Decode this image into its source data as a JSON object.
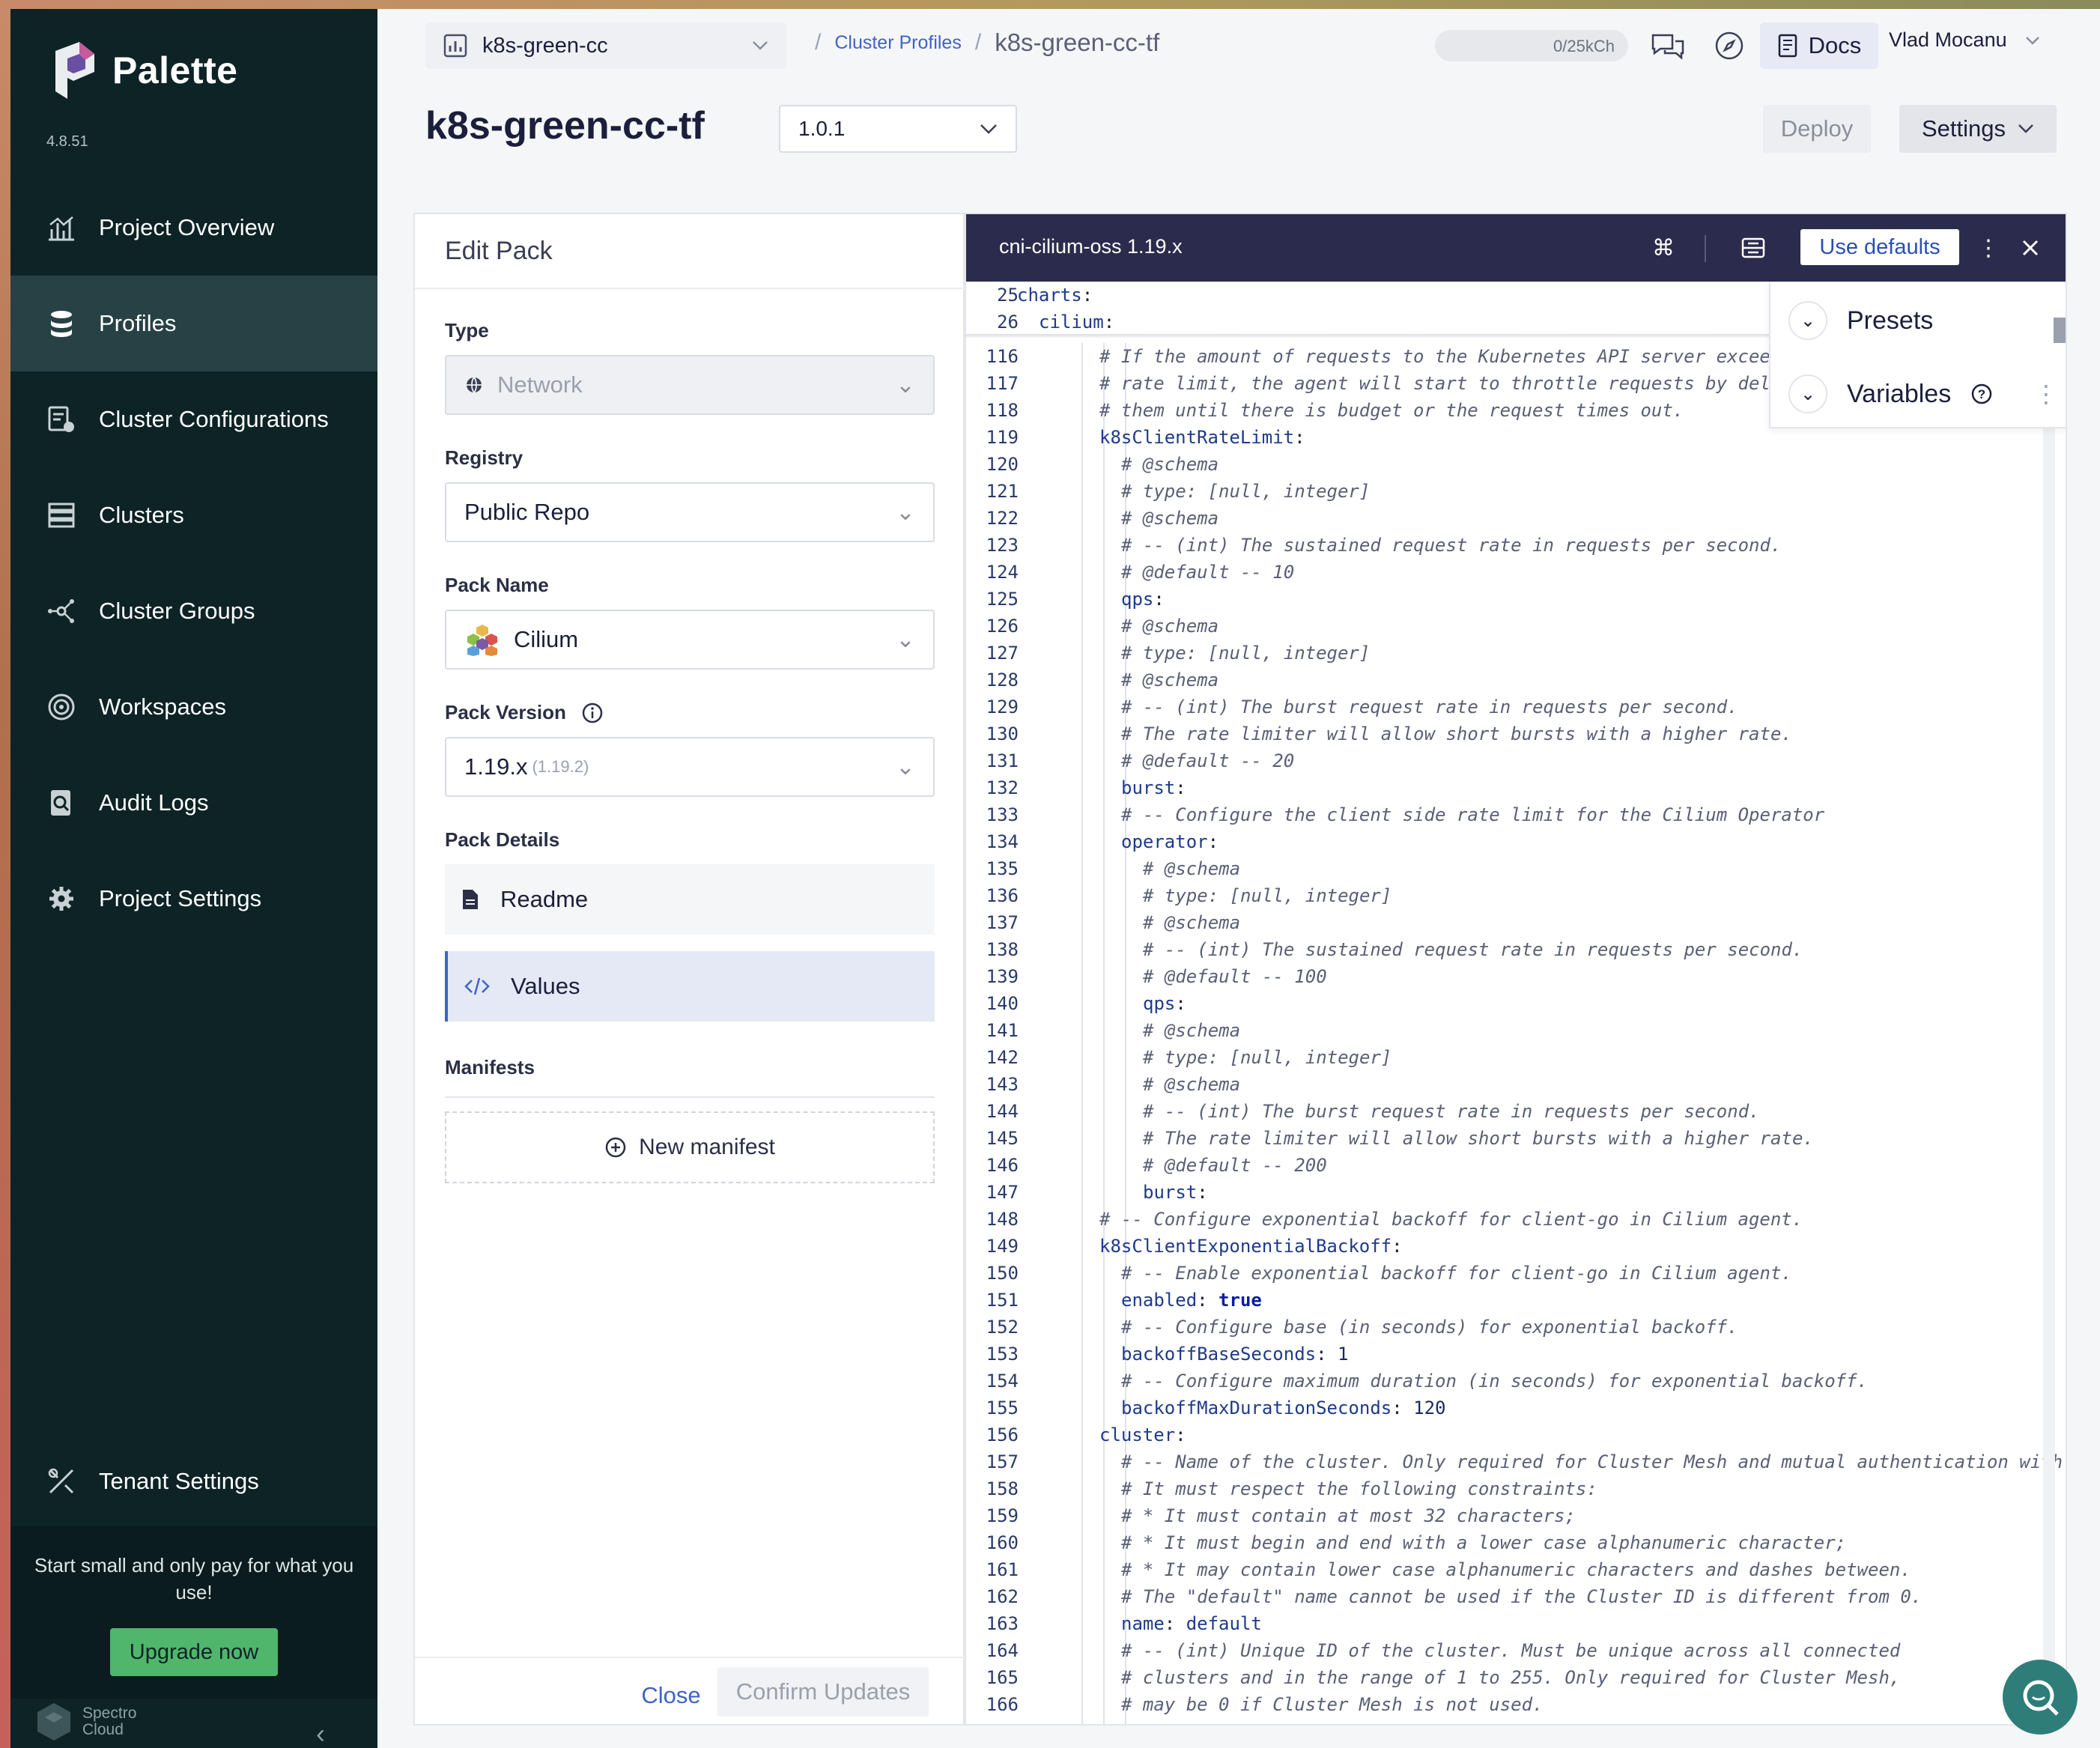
{
  "app": {
    "name": "Palette",
    "version": "4.8.51"
  },
  "sidebar": {
    "items": [
      {
        "label": "Project Overview",
        "icon": "chart-icon"
      },
      {
        "label": "Profiles",
        "icon": "layers-icon",
        "active": true
      },
      {
        "label": "Cluster Configurations",
        "icon": "config-icon"
      },
      {
        "label": "Clusters",
        "icon": "servers-icon"
      },
      {
        "label": "Cluster Groups",
        "icon": "network-icon"
      },
      {
        "label": "Workspaces",
        "icon": "target-icon"
      },
      {
        "label": "Audit Logs",
        "icon": "audit-icon"
      },
      {
        "label": "Project Settings",
        "icon": "gear-icon"
      }
    ],
    "tenant_settings": "Tenant Settings",
    "promo_text": "Start small and only pay for what you use!",
    "upgrade_label": "Upgrade now",
    "footer_brand_line1": "Spectro",
    "footer_brand_line2": "Cloud"
  },
  "header": {
    "project": "k8s-green-cc",
    "breadcrumb_link": "Cluster Profiles",
    "breadcrumb_current": "k8s-green-cc-tf",
    "usage": "0/25kCh",
    "docs_label": "Docs",
    "user_name": "Vlad Mocanu"
  },
  "profile": {
    "title": "k8s-green-cc-tf",
    "version": "1.0.1",
    "deploy_label": "Deploy",
    "settings_label": "Settings"
  },
  "edit_pack": {
    "title": "Edit Pack",
    "type_label": "Type",
    "type_value": "Network",
    "registry_label": "Registry",
    "registry_value": "Public Repo",
    "pack_name_label": "Pack Name",
    "pack_name_value": "Cilium",
    "pack_version_label": "Pack Version",
    "pack_version_value": "1.19.x",
    "pack_version_sub": "(1.19.2)",
    "pack_details_label": "Pack Details",
    "readme_label": "Readme",
    "values_label": "Values",
    "manifests_label": "Manifests",
    "new_manifest_label": "New manifest",
    "close_label": "Close",
    "confirm_label": "Confirm Updates"
  },
  "editor": {
    "title": "cni-cilium-oss 1.19.x",
    "use_defaults_label": "Use defaults",
    "presets_label": "Presets",
    "variables_label": "Variables",
    "sticky_lines": [
      {
        "n": "25",
        "indent": 0,
        "text": "charts:"
      },
      {
        "n": "26",
        "indent": 1,
        "text": "cilium:"
      }
    ],
    "lines": [
      {
        "n": "116",
        "indent": 2,
        "text": "# If the amount of requests to the Kubernetes API server excee"
      },
      {
        "n": "117",
        "indent": 2,
        "text": "# rate limit, the agent will start to throttle requests by del"
      },
      {
        "n": "118",
        "indent": 2,
        "text": "# them until there is budget or the request times out."
      },
      {
        "n": "119",
        "indent": 2,
        "text": "k8sClientRateLimit:"
      },
      {
        "n": "120",
        "indent": 3,
        "text": "# @schema"
      },
      {
        "n": "121",
        "indent": 3,
        "text": "# type: [null, integer]"
      },
      {
        "n": "122",
        "indent": 3,
        "text": "# @schema"
      },
      {
        "n": "123",
        "indent": 3,
        "text": "# -- (int) The sustained request rate in requests per second."
      },
      {
        "n": "124",
        "indent": 3,
        "text": "# @default -- 10"
      },
      {
        "n": "125",
        "indent": 3,
        "text": "qps:"
      },
      {
        "n": "126",
        "indent": 3,
        "text": "# @schema"
      },
      {
        "n": "127",
        "indent": 3,
        "text": "# type: [null, integer]"
      },
      {
        "n": "128",
        "indent": 3,
        "text": "# @schema"
      },
      {
        "n": "129",
        "indent": 3,
        "text": "# -- (int) The burst request rate in requests per second."
      },
      {
        "n": "130",
        "indent": 3,
        "text": "# The rate limiter will allow short bursts with a higher rate."
      },
      {
        "n": "131",
        "indent": 3,
        "text": "# @default -- 20"
      },
      {
        "n": "132",
        "indent": 3,
        "text": "burst:"
      },
      {
        "n": "133",
        "indent": 3,
        "text": "# -- Configure the client side rate limit for the Cilium Operator"
      },
      {
        "n": "134",
        "indent": 3,
        "text": "operator:"
      },
      {
        "n": "135",
        "indent": 4,
        "text": "# @schema"
      },
      {
        "n": "136",
        "indent": 4,
        "text": "# type: [null, integer]"
      },
      {
        "n": "137",
        "indent": 4,
        "text": "# @schema"
      },
      {
        "n": "138",
        "indent": 4,
        "text": "# -- (int) The sustained request rate in requests per second."
      },
      {
        "n": "139",
        "indent": 4,
        "text": "# @default -- 100"
      },
      {
        "n": "140",
        "indent": 4,
        "text": "qps:"
      },
      {
        "n": "141",
        "indent": 4,
        "text": "# @schema"
      },
      {
        "n": "142",
        "indent": 4,
        "text": "# type: [null, integer]"
      },
      {
        "n": "143",
        "indent": 4,
        "text": "# @schema"
      },
      {
        "n": "144",
        "indent": 4,
        "text": "# -- (int) The burst request rate in requests per second."
      },
      {
        "n": "145",
        "indent": 4,
        "text": "# The rate limiter will allow short bursts with a higher rate."
      },
      {
        "n": "146",
        "indent": 4,
        "text": "# @default -- 200"
      },
      {
        "n": "147",
        "indent": 4,
        "text": "burst:"
      },
      {
        "n": "148",
        "indent": 2,
        "text": "# -- Configure exponential backoff for client-go in Cilium agent."
      },
      {
        "n": "149",
        "indent": 2,
        "text": "k8sClientExponentialBackoff:"
      },
      {
        "n": "150",
        "indent": 3,
        "text": "# -- Enable exponential backoff for client-go in Cilium agent."
      },
      {
        "n": "151",
        "indent": 3,
        "text": "enabled: true"
      },
      {
        "n": "152",
        "indent": 3,
        "text": "# -- Configure base (in seconds) for exponential backoff."
      },
      {
        "n": "153",
        "indent": 3,
        "text": "backoffBaseSeconds: 1"
      },
      {
        "n": "154",
        "indent": 3,
        "text": "# -- Configure maximum duration (in seconds) for exponential backoff."
      },
      {
        "n": "155",
        "indent": 3,
        "text": "backoffMaxDurationSeconds: 120"
      },
      {
        "n": "156",
        "indent": 2,
        "text": "cluster:"
      },
      {
        "n": "157",
        "indent": 3,
        "text": "# -- Name of the cluster. Only required for Cluster Mesh and mutual authentication with"
      },
      {
        "n": "158",
        "indent": 3,
        "text": "# It must respect the following constraints:"
      },
      {
        "n": "159",
        "indent": 3,
        "text": "# * It must contain at most 32 characters;"
      },
      {
        "n": "160",
        "indent": 3,
        "text": "# * It must begin and end with a lower case alphanumeric character;"
      },
      {
        "n": "161",
        "indent": 3,
        "text": "# * It may contain lower case alphanumeric characters and dashes between."
      },
      {
        "n": "162",
        "indent": 3,
        "text": "# The \"default\" name cannot be used if the Cluster ID is different from 0."
      },
      {
        "n": "163",
        "indent": 3,
        "text": "name: default"
      },
      {
        "n": "164",
        "indent": 3,
        "text": "# -- (int) Unique ID of the cluster. Must be unique across all connected"
      },
      {
        "n": "165",
        "indent": 3,
        "text": "# clusters and in the range of 1 to 255. Only required for Cluster Mesh,"
      },
      {
        "n": "166",
        "indent": 3,
        "text": "# may be 0 if Cluster Mesh is not used."
      }
    ]
  },
  "colors": {
    "sidebar_bg": "#0d2326",
    "active_bg": "#274145",
    "accent": "#3f63c6",
    "editor_header": "#2b2c4d",
    "upgrade": "#4fb66b"
  }
}
